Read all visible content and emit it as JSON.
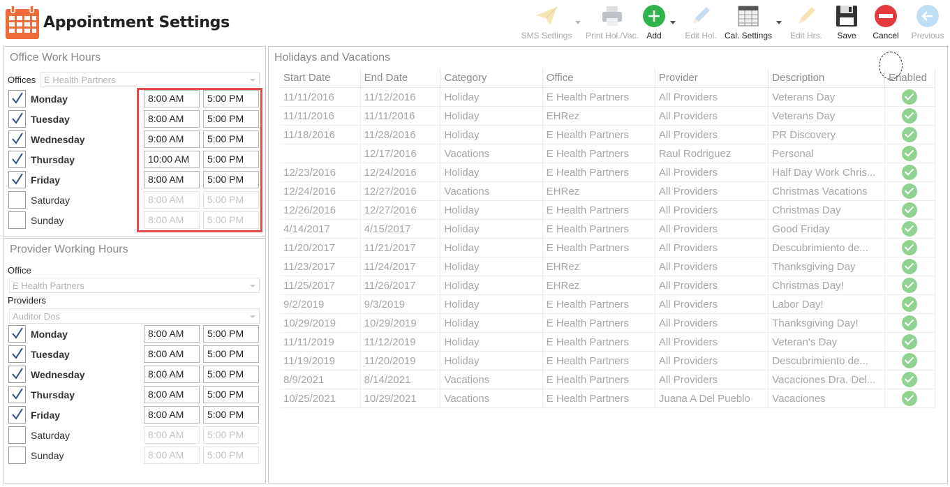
{
  "app": {
    "title": "Appointment Settings"
  },
  "colors": {
    "accent_red": "#e14b4b",
    "calendar_orange": "#ee6b3a",
    "add_green": "#2fb34b",
    "cancel_red": "#e23b3b",
    "enabled_green": "#8ed38f"
  },
  "toolbar": {
    "sms": "SMS Settings",
    "print": "Print Hol./Vac.",
    "add": "Add",
    "edit_hol": "Edit Hol.",
    "cal_settings": "Cal. Settings",
    "edit_hrs": "Edit Hrs.",
    "save": "Save",
    "cancel": "Cancel",
    "previous": "Previous"
  },
  "office_hours": {
    "title": "Office Work Hours",
    "offices_label": "Offices",
    "office_value": "E Health Partners",
    "days": [
      {
        "name": "Monday",
        "checked": true,
        "start": "8:00 AM",
        "end": "5:00 PM"
      },
      {
        "name": "Tuesday",
        "checked": true,
        "start": "8:00 AM",
        "end": "5:00 PM"
      },
      {
        "name": "Wednesday",
        "checked": true,
        "start": "9:00 AM",
        "end": "5:00 PM"
      },
      {
        "name": "Thursday",
        "checked": true,
        "start": "10:00 AM",
        "end": "5:00 PM"
      },
      {
        "name": "Friday",
        "checked": true,
        "start": "8:00 AM",
        "end": "5:00 PM"
      },
      {
        "name": "Saturday",
        "checked": false,
        "start": "8:00 AM",
        "end": "5:00 PM"
      },
      {
        "name": "Sunday",
        "checked": false,
        "start": "8:00 AM",
        "end": "5:00 PM"
      }
    ]
  },
  "provider_hours": {
    "title": "Provider Working Hours",
    "office_label": "Office",
    "office_value": "E Health Partners",
    "providers_label": "Providers",
    "provider_value": "Auditor Dos",
    "days": [
      {
        "name": "Monday",
        "checked": true,
        "start": "8:00 AM",
        "end": "5:00 PM"
      },
      {
        "name": "Tuesday",
        "checked": true,
        "start": "8:00 AM",
        "end": "5:00 PM"
      },
      {
        "name": "Wednesday",
        "checked": true,
        "start": "8:00 AM",
        "end": "5:00 PM"
      },
      {
        "name": "Thursday",
        "checked": true,
        "start": "8:00 AM",
        "end": "5:00 PM"
      },
      {
        "name": "Friday",
        "checked": true,
        "start": "8:00 AM",
        "end": "5:00 PM"
      },
      {
        "name": "Saturday",
        "checked": false,
        "start": "8:00 AM",
        "end": "5:00 PM"
      },
      {
        "name": "Sunday",
        "checked": false,
        "start": "8:00 AM",
        "end": "5:00 PM"
      }
    ]
  },
  "holidays": {
    "title": "Holidays and Vacations",
    "columns": [
      "Start Date",
      "End Date",
      "Category",
      "Office",
      "Provider",
      "Description",
      "Enabled"
    ],
    "rows": [
      [
        "11/11/2016",
        "11/12/2016",
        "Holiday",
        "E Health Partners",
        "All Providers",
        "Veterans Day",
        true
      ],
      [
        "11/11/2016",
        "11/11/2016",
        "Holiday",
        "EHRez",
        "All Providers",
        "Veterans Day",
        true
      ],
      [
        "11/18/2016",
        "11/28/2016",
        "Holiday",
        "E Health Partners",
        "All Providers",
        "PR Discovery",
        true
      ],
      [
        "",
        "12/17/2016",
        "Vacations",
        "E Health Partners",
        "Raul Rodriguez",
        "Personal",
        true
      ],
      [
        "12/23/2016",
        "12/24/2016",
        "Holiday",
        "E Health Partners",
        "All Providers",
        "Half Day Work Chris...",
        true
      ],
      [
        "12/24/2016",
        "12/27/2016",
        "Vacations",
        "EHRez",
        "All Providers",
        "Christmas Vacations",
        true
      ],
      [
        "12/26/2016",
        "12/27/2016",
        "Holiday",
        "E Health Partners",
        "All Providers",
        "Christmas Day",
        true
      ],
      [
        "4/14/2017",
        "4/15/2017",
        "Holiday",
        "E Health Partners",
        "All Providers",
        "Good Friday",
        true
      ],
      [
        "11/20/2017",
        "11/21/2017",
        "Holiday",
        "E Health Partners",
        "All Providers",
        "Descubrimiento de...",
        true
      ],
      [
        "11/23/2017",
        "11/24/2017",
        "Holiday",
        "EHRez",
        "All Providers",
        "Thanksgiving Day",
        true
      ],
      [
        "11/25/2017",
        "11/26/2017",
        "Holiday",
        "EHRez",
        "All Providers",
        "Christmas Day!",
        true
      ],
      [
        "9/2/2019",
        "9/3/2019",
        "Holiday",
        "E Health Partners",
        "All Providers",
        "Labor Day!",
        true
      ],
      [
        "10/29/2019",
        "10/29/2019",
        "Holiday",
        "E Health Partners",
        "All Providers",
        "Thanksgiving Day!",
        true
      ],
      [
        "11/11/2019",
        "11/12/2019",
        "Holiday",
        "E Health Partners",
        "All Providers",
        "Veteran's Day",
        true
      ],
      [
        "11/19/2019",
        "11/20/2019",
        "Holiday",
        "E Health Partners",
        "All Providers",
        "Descubrimiento de...",
        true
      ],
      [
        "8/9/2021",
        "8/14/2021",
        "Vacations",
        "E Health Partners",
        "All Providers",
        "Vacaciones Dra. Del...",
        true
      ],
      [
        "10/25/2021",
        "10/29/2021",
        "Vacations",
        "E Health Partners",
        "Juana A Del Pueblo",
        "Vacaciones",
        true
      ]
    ]
  }
}
